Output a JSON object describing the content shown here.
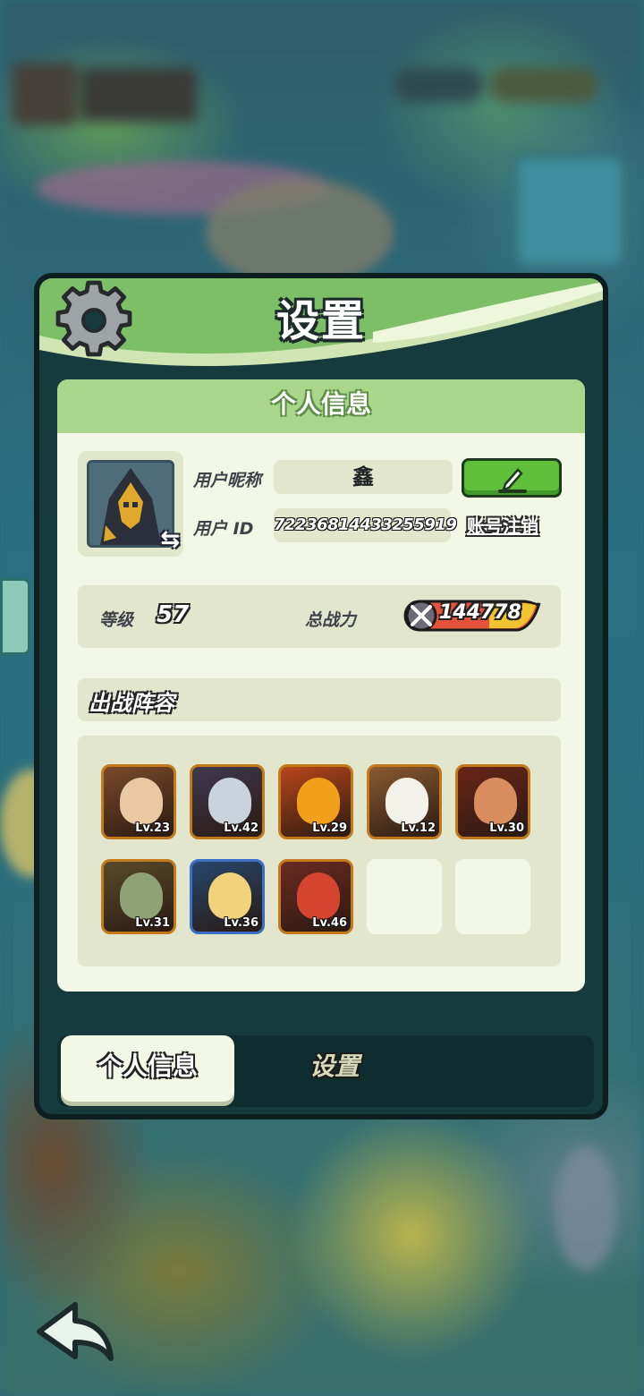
{
  "dialog": {
    "title": "设置",
    "section_title": "个人信息"
  },
  "profile": {
    "nickname_label": "用户昵称",
    "nickname": "鑫",
    "id_label": "用户 ID",
    "user_id": "72236814433255919",
    "cancel_account": "账号注销",
    "level_label": "等级",
    "level": "57",
    "power_label": "总战力",
    "power": "144778"
  },
  "lineup": {
    "title": "出战阵容",
    "heroes": [
      {
        "level": "Lv.23",
        "frame": "orange",
        "color": "#7a4a2a",
        "face": "#e8c9a2"
      },
      {
        "level": "Lv.42",
        "frame": "orange",
        "color": "#3f3950",
        "face": "#c9d3dc"
      },
      {
        "level": "Lv.29",
        "frame": "orange",
        "color": "#b8461a",
        "face": "#f2a019"
      },
      {
        "level": "Lv.12",
        "frame": "orange",
        "color": "#8a5a30",
        "face": "#f3f2ea"
      },
      {
        "level": "Lv.30",
        "frame": "orange",
        "color": "#6a2418",
        "face": "#d98d5f"
      },
      {
        "level": "Lv.31",
        "frame": "orange",
        "color": "#5a4a2a",
        "face": "#8fa276"
      },
      {
        "level": "Lv.36",
        "frame": "blue",
        "color": "#26466b",
        "face": "#f2d27a"
      },
      {
        "level": "Lv.46",
        "frame": "orange",
        "color": "#6b2a22",
        "face": "#d4442f"
      }
    ],
    "empty_slots": 2
  },
  "tabs": [
    {
      "label": "个人信息",
      "active": true
    },
    {
      "label": "设置",
      "active": false
    }
  ],
  "colors": {
    "header_green": "#7cbf67",
    "card_bg": "#f3f7e5",
    "edit_button": "#5fbe3a"
  },
  "icons": [
    "gear-icon",
    "edit-pencil-icon",
    "swap-arrow-icon",
    "sword-power-icon",
    "back-arrow-icon"
  ]
}
